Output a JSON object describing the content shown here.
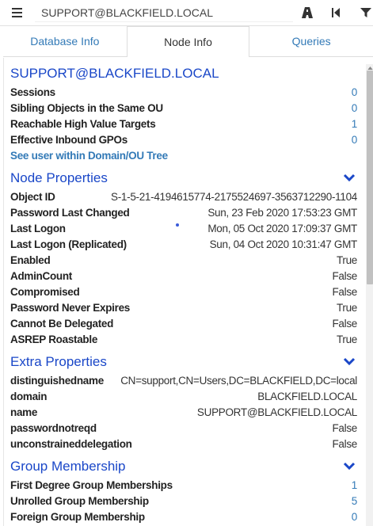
{
  "search": {
    "value": "SUPPORT@BLACKFIELD.LOCAL"
  },
  "icons": {
    "menu": "hamburger-icon",
    "path": "road-icon",
    "back": "step-backward-icon",
    "filter": "filter-icon"
  },
  "colors": {
    "link": "#337ab7",
    "section_title": "#1a47c8"
  },
  "tabs": [
    {
      "label": "Database Info",
      "active": false
    },
    {
      "label": "Node Info",
      "active": true
    },
    {
      "label": "Queries",
      "active": false
    }
  ],
  "node": {
    "name": "SUPPORT@BLACKFIELD.LOCAL",
    "overview": [
      {
        "label": "Sessions",
        "value": "0"
      },
      {
        "label": "Sibling Objects in the Same OU",
        "value": "0"
      },
      {
        "label": "Reachable High Value Targets",
        "value": "1"
      },
      {
        "label": "Effective Inbound GPOs",
        "value": "0"
      }
    ],
    "tree_link": "See user within Domain/OU Tree"
  },
  "node_properties": {
    "title": "Node Properties",
    "rows": [
      {
        "label": "Object ID",
        "value": "S-1-5-21-4194615774-2175524697-3563712290-1104"
      },
      {
        "label": "Password Last Changed",
        "value": "Sun, 23 Feb 2020 17:53:23 GMT"
      },
      {
        "label": "Last Logon",
        "value": "Mon, 05 Oct 2020 17:09:37 GMT"
      },
      {
        "label": "Last Logon (Replicated)",
        "value": "Sun, 04 Oct 2020 10:31:47 GMT"
      },
      {
        "label": "Enabled",
        "value": "True"
      },
      {
        "label": "AdminCount",
        "value": "False"
      },
      {
        "label": "Compromised",
        "value": "False"
      },
      {
        "label": "Password Never Expires",
        "value": "True"
      },
      {
        "label": "Cannot Be Delegated",
        "value": "False"
      },
      {
        "label": "ASREP Roastable",
        "value": "True"
      }
    ]
  },
  "extra_properties": {
    "title": "Extra Properties",
    "rows": [
      {
        "label": "distinguishedname",
        "value": "CN=support,CN=Users,DC=BLACKFIELD,DC=local"
      },
      {
        "label": "domain",
        "value": "BLACKFIELD.LOCAL"
      },
      {
        "label": "name",
        "value": "SUPPORT@BLACKFIELD.LOCAL"
      },
      {
        "label": "passwordnotreqd",
        "value": "False"
      },
      {
        "label": "unconstraineddelegation",
        "value": "False"
      }
    ]
  },
  "group_membership": {
    "title": "Group Membership",
    "rows": [
      {
        "label": "First Degree Group Memberships",
        "value": "1"
      },
      {
        "label": "Unrolled Group Membership",
        "value": "5"
      },
      {
        "label": "Foreign Group Membership",
        "value": "0"
      }
    ]
  }
}
